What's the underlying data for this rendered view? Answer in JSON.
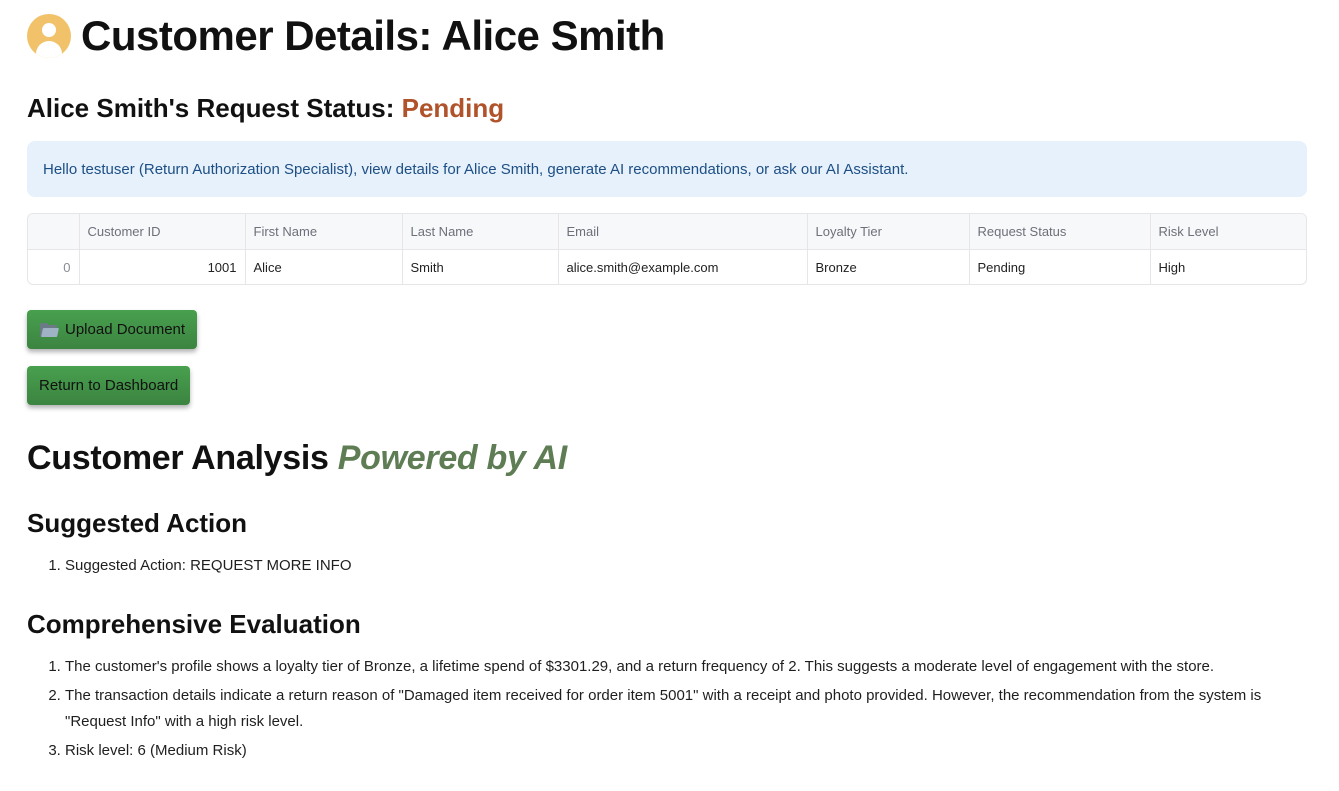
{
  "header": {
    "title": "Customer Details: Alice Smith",
    "icon": "user-avatar-icon",
    "avatar_color": "#f2c26a"
  },
  "status": {
    "label": "Alice Smith's Request Status: ",
    "value": "Pending",
    "value_color": "#b0532a"
  },
  "info_message": "Hello testuser (Return Authorization Specialist), view details for Alice Smith, generate AI recommendations, or ask our AI Assistant.",
  "table": {
    "columns": [
      "",
      "Customer ID",
      "First Name",
      "Last Name",
      "Email",
      "Loyalty Tier",
      "Request Status",
      "Risk Level"
    ],
    "rows": [
      [
        "0",
        "1001",
        "Alice",
        "Smith",
        "alice.smith@example.com",
        "Bronze",
        "Pending",
        "High"
      ]
    ]
  },
  "buttons": {
    "upload_label": "Upload Document",
    "upload_icon": "folder-icon",
    "return_label": "Return to Dashboard",
    "color": "#3f8f45"
  },
  "analysis": {
    "title": "Customer Analysis ",
    "accent": "Powered by AI",
    "accent_color": "#5e7d54"
  },
  "suggested_action": {
    "heading": "Suggested Action",
    "items": [
      "Suggested Action: REQUEST MORE INFO"
    ]
  },
  "evaluation": {
    "heading": "Comprehensive Evaluation",
    "items": [
      "The customer's profile shows a loyalty tier of Bronze, a lifetime spend of $3301.29, and a return frequency of 2. This suggests a moderate level of engagement with the store.",
      "The transaction details indicate a return reason of \"Damaged item received for order item 5001\" with a receipt and photo provided. However, the recommendation from the system is \"Request Info\" with a high risk level.",
      "Risk level: 6 (Medium Risk)"
    ]
  }
}
